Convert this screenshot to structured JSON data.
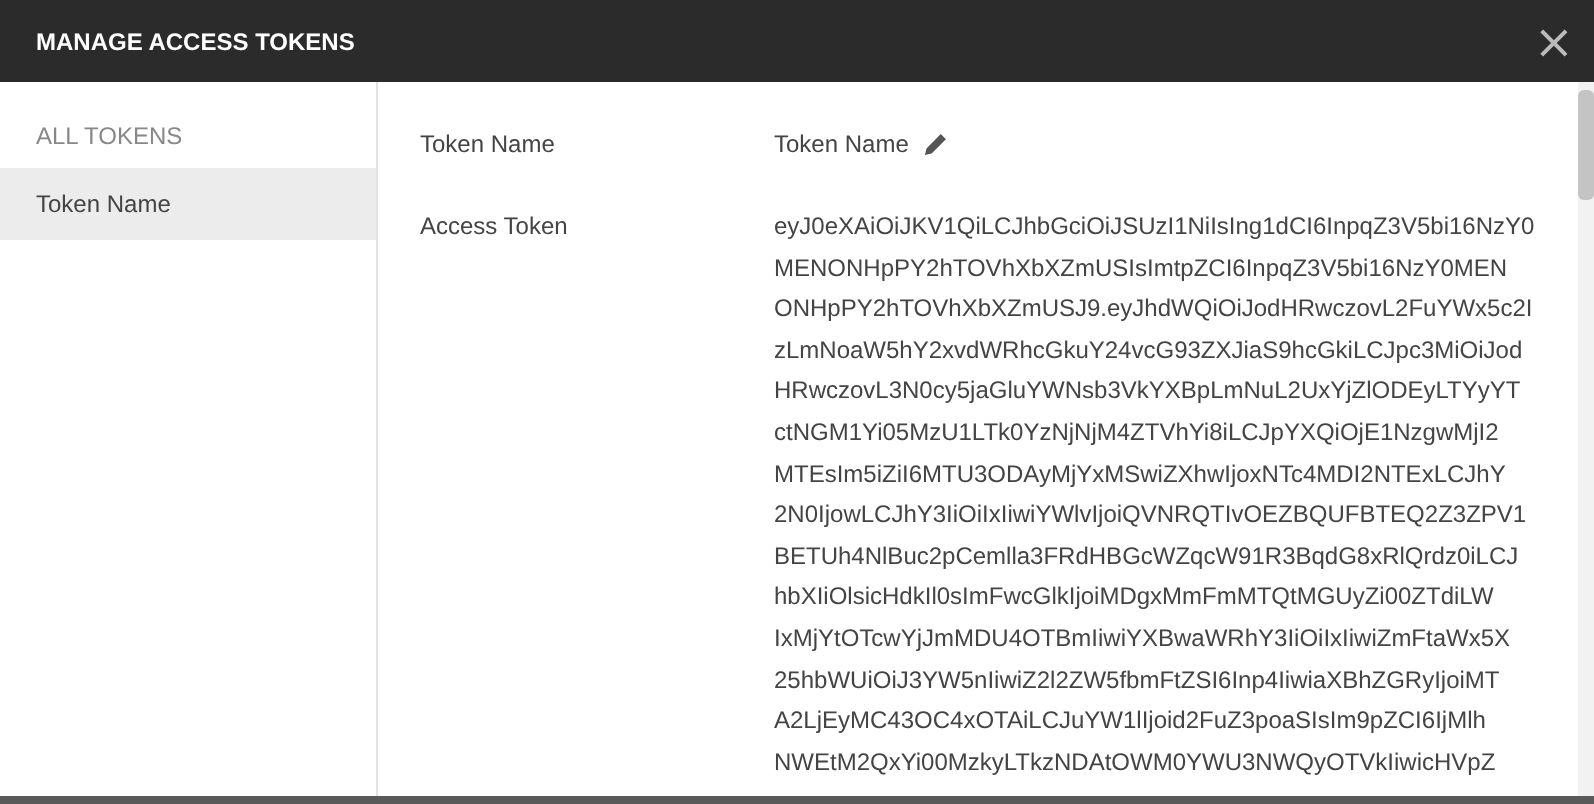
{
  "window": {
    "title": "MANAGE ACCESS TOKENS",
    "close": "×"
  },
  "sidebar": {
    "heading": "ALL TOKENS",
    "items": [
      {
        "label": "Token Name",
        "selected": true
      }
    ]
  },
  "details": {
    "fields": [
      {
        "kind": "editable",
        "label": "Token Name",
        "value": "Token Name"
      },
      {
        "kind": "lines",
        "label": "Access Token",
        "lines": [
          "eyJ0eXAiOiJKV1QiLCJhbGciOiJSUzI1NiIsIng1dCI6InpqZ3V5bi16NzY0",
          "MENONHpPY2hTOVhXbXZmUSIsImtpZCI6InpqZ3V5bi16NzY0MEN",
          "ONHpPY2hTOVhXbXZmUSJ9.eyJhdWQiOiJodHRwczovL2FuYWx5c2I",
          "zLmNoaW5hY2xvdWRhcGkuY24vcG93ZXJiaS9hcGkiLCJpc3MiOiJod",
          "HRwczovL3N0cy5jaGluYWNsb3VkYXBpLmNuL2UxYjZlODEyLTYyYT",
          "ctNGM1Yi05MzU1LTk0YzNjNjM4ZTVhYi8iLCJpYXQiOjE1NzgwMjI2",
          "MTEsIm5iZiI6MTU3ODAyMjYxMSwiZXhwIjoxNTc4MDI2NTExLCJhY",
          "2N0IjowLCJhY3IiOiIxIiwiYWlvIjoiQVNRQTIvOEZBQUFBTEQ2Z3ZPV1",
          "BETUh4NlBuc2pCemlla3FRdHBGcWZqcW91R3BqdG8xRlQrdz0iLCJ",
          "hbXIiOlsicHdkIl0sImFwcGlkIjoiMDgxMmFmMTQtMGUyZi00ZTdiLW",
          "IxMjYtOTcwYjJmMDU4OTBmIiwiYXBwaWRhY3IiOiIxIiwiZmFtaWx5X",
          "25hbWUiOiJ3YW5nIiwiZ2l2ZW5fbmFtZSI6Inp4IiwiaXBhZGRyIjoiMT",
          "A2LjEyMC43OC4xOTAiLCJuYW1lIjoid2FuZ3poaSIsIm9pZCI6IjMlh",
          "NWEtM2QxYi00MzkyLTkzNDAtOWM0YWU3NWQyOTVkIiwicHVpZ"
        ]
      }
    ]
  }
}
